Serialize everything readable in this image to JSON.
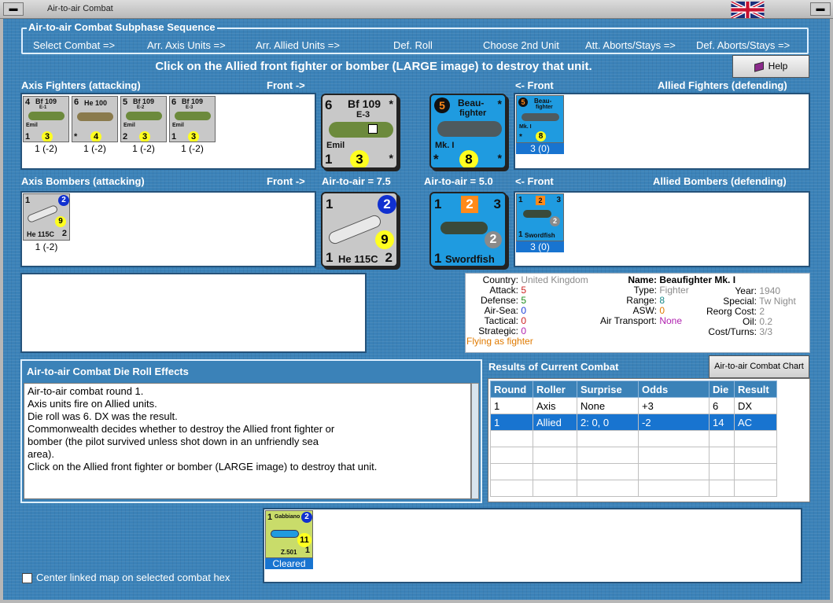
{
  "window": {
    "title": "Air-to-air Combat"
  },
  "sequence": {
    "title": "Air-to-air Combat Subphase Sequence",
    "steps": [
      "Select Combat =>",
      "Arr. Axis Units =>",
      "Arr. Allied Units =>",
      "Def. Roll",
      "Choose 2nd Unit",
      "Att. Aborts/Stays =>",
      "Def. Aborts/Stays =>"
    ]
  },
  "instruction": "Click on the Allied front fighter or bomber (LARGE image) to destroy that unit.",
  "help_label": "Help",
  "axis_fighters": {
    "header": "Axis Fighters (attacking)",
    "front": "Front ->",
    "units": [
      {
        "tl": "4",
        "name": "Bf 109",
        "sub": "E-1",
        "note": "Emil",
        "bl": "1",
        "circle": "3",
        "caption": "1 (-2)"
      },
      {
        "tl": "6",
        "name": "He 100",
        "sub": "",
        "note": "",
        "bl": "*",
        "circle": "4",
        "caption": "1 (-2)"
      },
      {
        "tl": "5",
        "name": "Bf 109",
        "sub": "E-2",
        "note": "Emil",
        "bl": "2",
        "circle": "3",
        "caption": "1 (-2)"
      },
      {
        "tl": "6",
        "name": "Bf 109",
        "sub": "E-3",
        "note": "Emil",
        "bl": "1",
        "circle": "3",
        "caption": "1 (-2)"
      }
    ]
  },
  "axis_front_fighter": {
    "tl": "6",
    "name": "Bf 109",
    "sub": "E-3",
    "note": "Emil",
    "bl": "1",
    "circle": "3",
    "star": "*"
  },
  "allied_front_fighter": {
    "tl": "5",
    "name": "Beau-",
    "name2": "fighter",
    "note": "Mk. I",
    "bl": "*",
    "circle": "8",
    "star": "*"
  },
  "allied_fighters": {
    "header": "Allied Fighters (defending)",
    "front": "<- Front",
    "units": [
      {
        "tl": "5",
        "name": "Beau-",
        "name2": "fighter",
        "note": "Mk. I",
        "bl": "*",
        "circle": "8",
        "caption": "3 (0)"
      }
    ]
  },
  "axis_bombers": {
    "header": "Axis Bombers (attacking)",
    "front": "Front ->",
    "units": [
      {
        "tl": "1",
        "name": "He 115C",
        "br": "2",
        "bluecircle": "2",
        "circle": "9",
        "caption": "1 (-2)"
      }
    ]
  },
  "air_to_air_axis": "Air-to-air = 7.5",
  "air_to_air_allied": "Air-to-air = 5.0",
  "axis_front_bomber": {
    "tl": "1",
    "name": "He 115C",
    "bl": "1",
    "br": "2",
    "bluecircle": "2",
    "circle": "9"
  },
  "allied_front_bomber": {
    "tl": "1",
    "sq": "2",
    "tr": "3",
    "name": "Swordfish",
    "bl": "1",
    "greycircle": "2"
  },
  "allied_bombers": {
    "header": "Allied Bombers (defending)",
    "front": "<- Front",
    "units": [
      {
        "tl": "1",
        "sq": "2",
        "tr": "3",
        "name": "Swordfish",
        "bl": "1",
        "greycircle": "2",
        "caption": "3 (0)"
      }
    ]
  },
  "unit_info": {
    "country_label": "Country:",
    "country": "United Kingdom",
    "attack_label": "Attack:",
    "attack": "5",
    "defense_label": "Defense:",
    "defense": "5",
    "airsea_label": "Air-Sea:",
    "airsea": "0",
    "tactical_label": "Tactical:",
    "tactical": "0",
    "strategic_label": "Strategic:",
    "strategic": "0",
    "flying": "Flying as fighter",
    "name_label": "Name:",
    "name": "Beaufighter Mk. I",
    "type_label": "Type:",
    "type": "Fighter",
    "range_label": "Range:",
    "range": "8",
    "asw_label": "ASW:",
    "asw": "0",
    "airtransport_label": "Air Transport:",
    "airtransport": "None",
    "year_label": "Year:",
    "year": "1940",
    "special_label": "Special:",
    "special": "Tw Night",
    "reorg_label": "Reorg Cost:",
    "reorg": "2",
    "oil_label": "Oil:",
    "oil": "0.2",
    "cost_label": "Cost/Turns:",
    "cost": "3/3"
  },
  "die_roll": {
    "title": "Air-to-air Combat Die Roll Effects",
    "lines": [
      "Air-to-air combat round 1.",
      "Axis units fire on Allied units.",
      "Die roll was 6.  DX was the result.",
      "Commonwealth decides whether to destroy the Allied front fighter or",
      "bomber (the pilot survived unless shot down in an unfriendly sea",
      "area).",
      "Click on the Allied front fighter or bomber (LARGE image) to destroy that unit."
    ]
  },
  "results": {
    "title": "Results of Current Combat",
    "chart_button": "Air-to-air Combat Chart",
    "columns": [
      "Round",
      "Roller",
      "Surprise",
      "Odds",
      "Die",
      "Result"
    ],
    "rows": [
      [
        "1",
        "Axis",
        "None",
        "+3",
        "6",
        "DX"
      ],
      [
        "1",
        "Allied",
        "2: 0, 0",
        "-2",
        "14",
        "AC"
      ]
    ]
  },
  "cleared": {
    "unit": {
      "tl": "1",
      "name": "Gabbiano",
      "bluecircle": "2",
      "circle": "11",
      "br": "1",
      "sub": "Z.501"
    },
    "caption": "Cleared"
  },
  "center_map_label": "Center linked map on selected combat hex",
  "colors": {
    "background": "#3b82b8",
    "selection": "#1874d0",
    "allied_counter": "#1f9be0",
    "axis_counter": "#c8c8c8"
  }
}
